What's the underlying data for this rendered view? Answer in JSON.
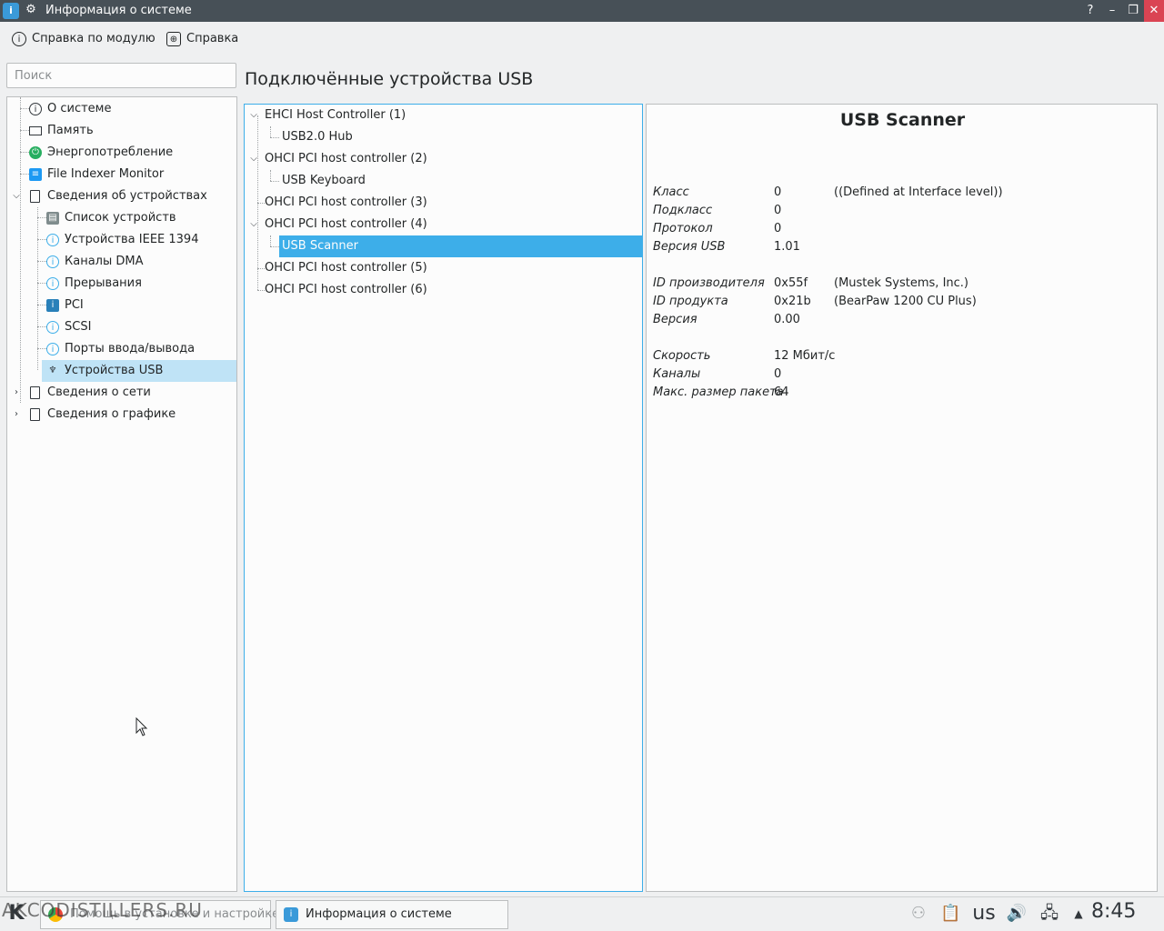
{
  "window": {
    "title": "Информация о системе",
    "buttons": {
      "help": "?",
      "minimize": "–",
      "restore": "❐",
      "close": "✕"
    }
  },
  "toolbar": {
    "module_help": "Справка по модулю",
    "help": "Справка"
  },
  "search": {
    "placeholder": "Поиск"
  },
  "sidebar": {
    "items": [
      {
        "label": "О системе",
        "icon": "info-icon"
      },
      {
        "label": "Память",
        "icon": "monitor-icon"
      },
      {
        "label": "Энергопотребление",
        "icon": "power-icon"
      },
      {
        "label": "File Indexer Monitor",
        "icon": "document-icon"
      },
      {
        "label": "Сведения об устройствах",
        "icon": "page-icon",
        "expanded": true
      },
      {
        "label": "Список устройств",
        "icon": "device-list-icon"
      },
      {
        "label": "Устройства IEEE 1394",
        "icon": "info-icon"
      },
      {
        "label": "Каналы DMA",
        "icon": "info-icon"
      },
      {
        "label": "Прерывания",
        "icon": "info-icon"
      },
      {
        "label": "PCI",
        "icon": "pci-icon"
      },
      {
        "label": "SCSI",
        "icon": "info-icon"
      },
      {
        "label": "Порты ввода/вывода",
        "icon": "info-icon"
      },
      {
        "label": "Устройства USB",
        "icon": "usb-icon",
        "selected": true
      },
      {
        "label": "Сведения о сети",
        "icon": "page-icon",
        "expanded": false
      },
      {
        "label": "Сведения о графике",
        "icon": "page-icon",
        "expanded": false
      }
    ]
  },
  "main": {
    "title": "Подключённые устройства USB",
    "tree": [
      {
        "label": "EHCI Host Controller (1)"
      },
      {
        "label": "USB2.0 Hub"
      },
      {
        "label": "OHCI PCI host controller (2)"
      },
      {
        "label": "USB Keyboard"
      },
      {
        "label": "OHCI PCI host controller (3)"
      },
      {
        "label": "OHCI PCI host controller (4)"
      },
      {
        "label": "USB Scanner",
        "selected": true
      },
      {
        "label": "OHCI PCI host controller (5)"
      },
      {
        "label": "OHCI PCI host controller (6)"
      }
    ]
  },
  "details": {
    "title": "USB Scanner",
    "rows": [
      {
        "key": "Класс",
        "value": "0",
        "extra": "((Defined at Interface level))"
      },
      {
        "key": "Подкласс",
        "value": "0",
        "extra": ""
      },
      {
        "key": "Протокол",
        "value": "0",
        "extra": ""
      },
      {
        "key": "Версия USB",
        "value": "1.01",
        "extra": ""
      },
      {
        "key": "ID производителя",
        "value": "0x55f",
        "extra": "(Mustek Systems, Inc.)"
      },
      {
        "key": "ID продукта",
        "value": "0x21b",
        "extra": "(BearPaw 1200 CU Plus)"
      },
      {
        "key": "Версия",
        "value": "0.00",
        "extra": ""
      },
      {
        "key": "Скорость",
        "value": "12 Мбит/с",
        "extra": ""
      },
      {
        "key": "Каналы",
        "value": "0",
        "extra": ""
      },
      {
        "key": "Макс. размер пакета",
        "value": "64",
        "extra": ""
      }
    ]
  },
  "taskbar": {
    "watermark": "AKCODISTILLERS.RU",
    "tasks": [
      {
        "label": "Помощь в установке и настройке"
      },
      {
        "label": "Информация о системе"
      }
    ],
    "keyboard_layout": "us",
    "clock": "8:45"
  },
  "colors": {
    "accent": "#3daee9",
    "titlebar": "#475057",
    "close": "#da4453",
    "sidebar_selected": "#bfe3f6"
  }
}
